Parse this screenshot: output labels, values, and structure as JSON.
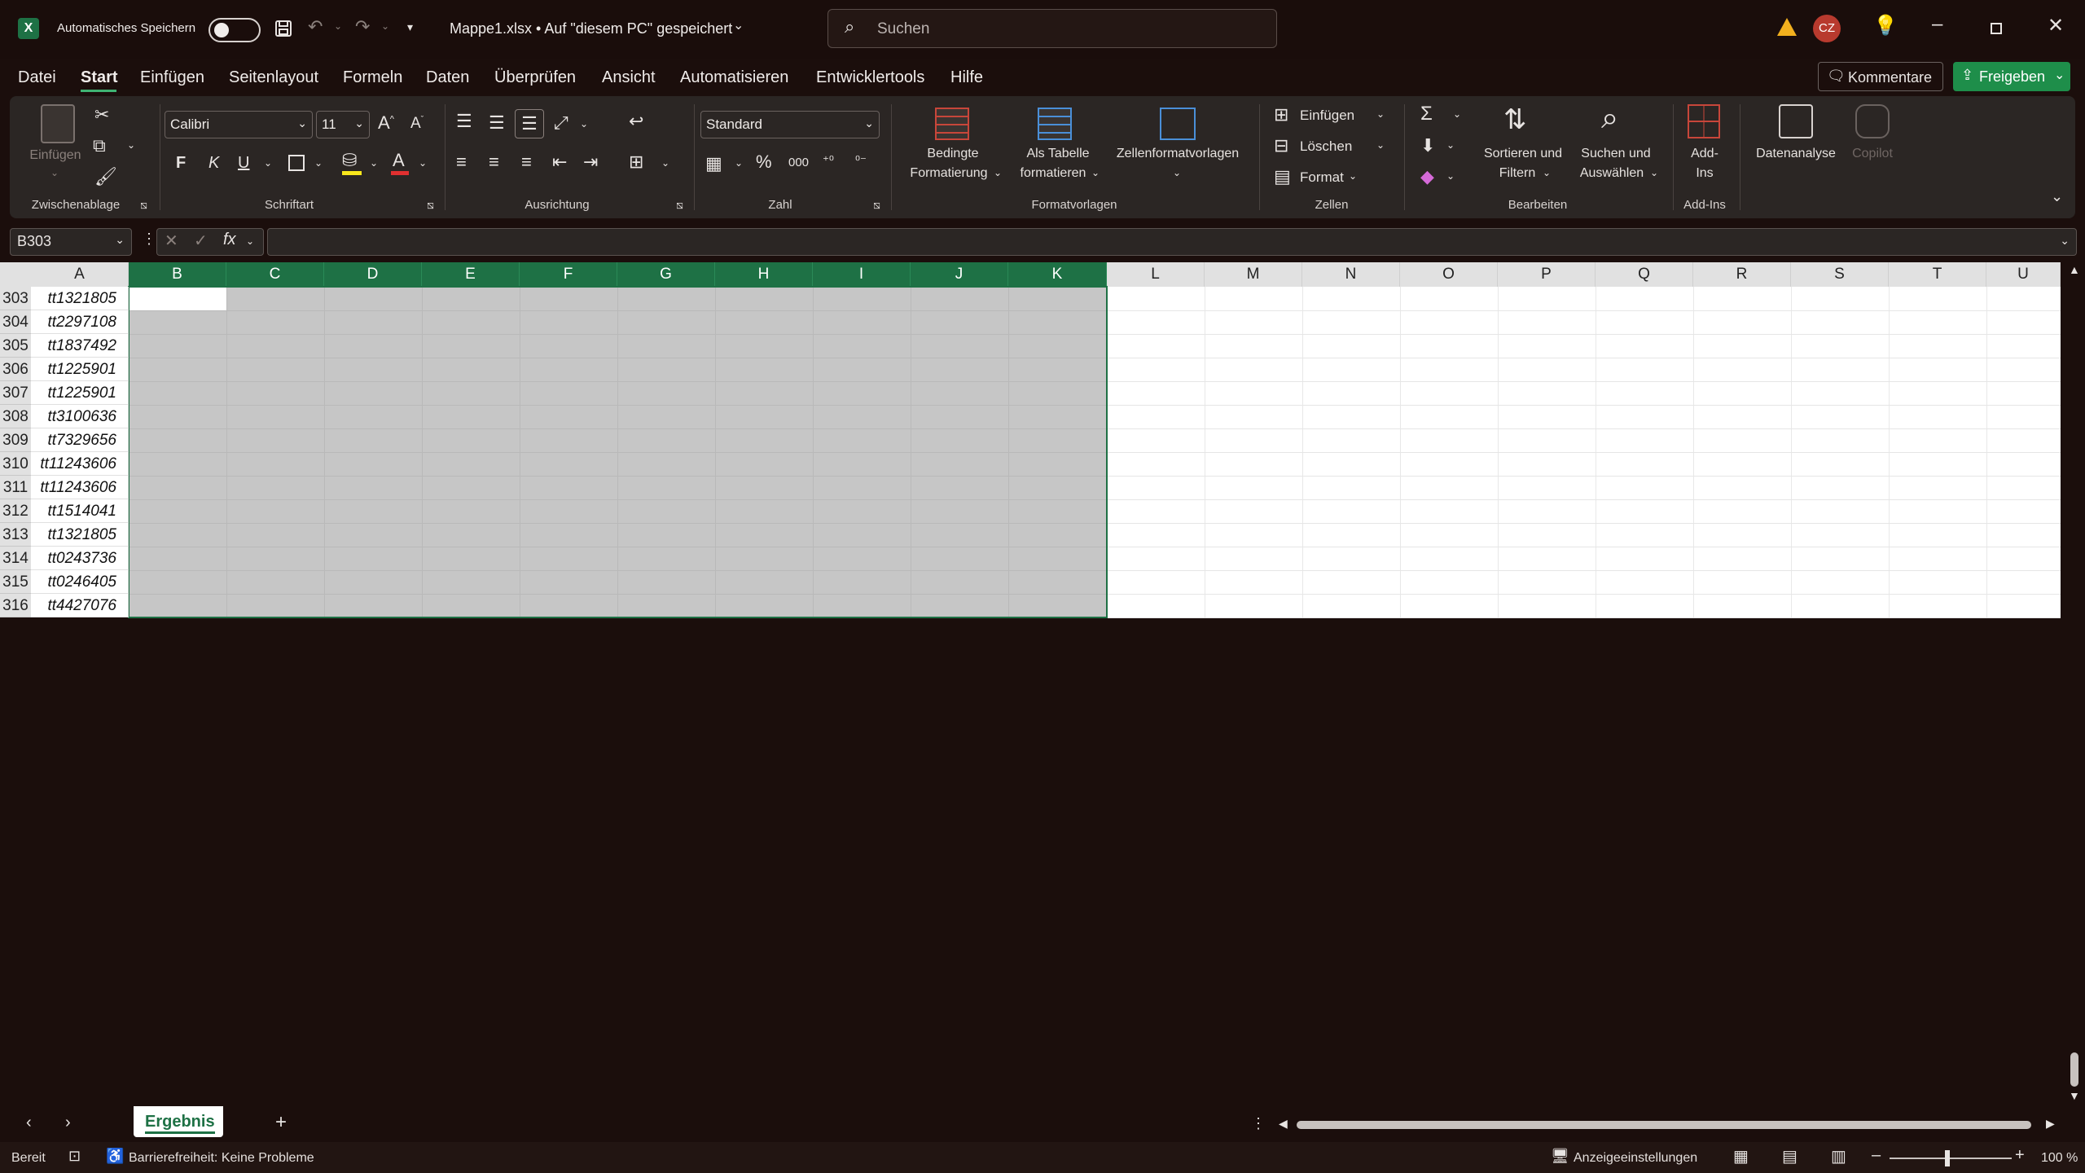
{
  "titlebar": {
    "autosave_label": "Automatisches Speichern",
    "file_title": "Mappe1.xlsx • Auf \"diesem PC\" gespeichert",
    "search_placeholder": "Suchen",
    "user_initials": "CZ"
  },
  "tabs": [
    "Datei",
    "Start",
    "Einfügen",
    "Seitenlayout",
    "Formeln",
    "Daten",
    "Überprüfen",
    "Ansicht",
    "Automatisieren",
    "Entwicklertools",
    "Hilfe"
  ],
  "active_tab": "Start",
  "buttons": {
    "comments": "Kommentare",
    "share": "Freigeben"
  },
  "ribbon": {
    "clipboard": {
      "paste": "Einfügen",
      "group": "Zwischenablage"
    },
    "font": {
      "name": "Calibri",
      "size": "11",
      "bold": "F",
      "italic": "K",
      "underline": "U",
      "group": "Schriftart"
    },
    "alignment": {
      "group": "Ausrichtung"
    },
    "number": {
      "format": "Standard",
      "group": "Zahl"
    },
    "styles": {
      "conditional_1": "Bedingte",
      "conditional_2": "Formatierung",
      "table_1": "Als Tabelle",
      "table_2": "formatieren",
      "cell_styles": "Zellenformatvorlagen",
      "group": "Formatvorlagen"
    },
    "cells": {
      "insert": "Einfügen",
      "delete": "Löschen",
      "format": "Format",
      "group": "Zellen"
    },
    "editing": {
      "sort_1": "Sortieren und",
      "sort_2": "Filtern",
      "find_1": "Suchen und",
      "find_2": "Auswählen",
      "group": "Bearbeiten"
    },
    "addins": {
      "label_1": "Add-",
      "label_2": "Ins",
      "group": "Add-Ins"
    },
    "analysis": {
      "data_analysis": "Datenanalyse",
      "copilot": "Copilot"
    }
  },
  "formula_bar": {
    "name_box": "B303",
    "fx": "fx",
    "content": ""
  },
  "columns": [
    "A",
    "B",
    "C",
    "D",
    "E",
    "F",
    "G",
    "H",
    "I",
    "J",
    "K",
    "L",
    "M",
    "N",
    "O",
    "P",
    "Q",
    "R",
    "S",
    "T",
    "U"
  ],
  "rows": [
    {
      "num": "303",
      "a": "tt1321805"
    },
    {
      "num": "304",
      "a": "tt2297108"
    },
    {
      "num": "305",
      "a": "tt1837492"
    },
    {
      "num": "306",
      "a": "tt1225901"
    },
    {
      "num": "307",
      "a": "tt1225901"
    },
    {
      "num": "308",
      "a": "tt3100636"
    },
    {
      "num": "309",
      "a": "tt7329656"
    },
    {
      "num": "310",
      "a": "tt11243606"
    },
    {
      "num": "311",
      "a": "tt11243606"
    },
    {
      "num": "312",
      "a": "tt1514041"
    },
    {
      "num": "313",
      "a": "tt1321805"
    },
    {
      "num": "314",
      "a": "tt0243736"
    },
    {
      "num": "315",
      "a": "tt0246405"
    },
    {
      "num": "316",
      "a": "tt4427076"
    }
  ],
  "sheet_tabs": [
    "Ergebnis"
  ],
  "status": {
    "ready": "Bereit",
    "accessibility": "Barrierefreiheit: Keine Probleme",
    "display_settings": "Anzeigeeinstellungen",
    "zoom": "100 %"
  },
  "colors": {
    "selection_header": "#1e7145",
    "selected_range": "#c6c6c6",
    "share_button": "#1e8e4a",
    "background": "#1b0e0c"
  }
}
